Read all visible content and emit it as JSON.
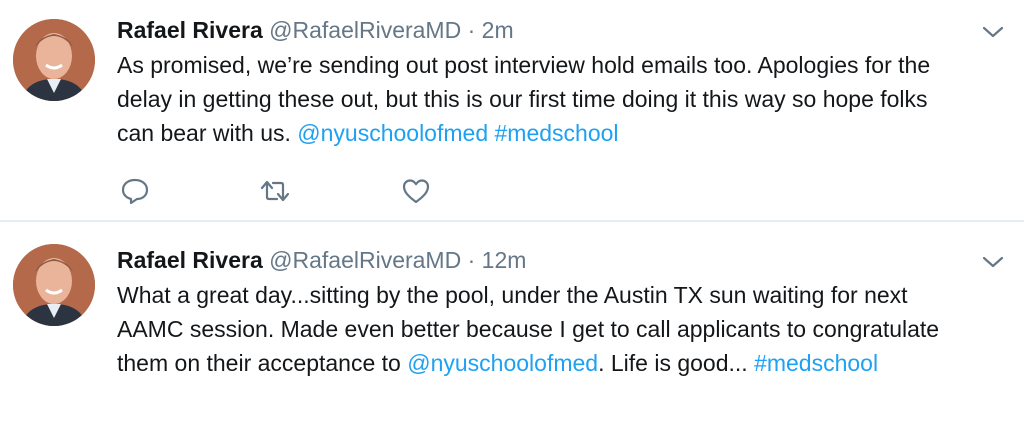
{
  "tweets": [
    {
      "name": "Rafael Rivera",
      "handle": "@RafaelRiveraMD",
      "separator": "·",
      "time": "2m",
      "text_1": "As promised, we’re sending out post interview hold emails too.  Apologies for the delay in getting these out, but this is our first time doing it this way so hope folks can bear with us.  ",
      "link_1": "@nyuschoolofmed",
      "text_2": " ",
      "link_2": "#medschool",
      "text_3": "",
      "link_3": "",
      "icons": {
        "reply": "reply-icon",
        "retweet": "retweet-icon",
        "like": "like-icon",
        "menu": "chevron-down-icon"
      }
    },
    {
      "name": "Rafael Rivera",
      "handle": "@RafaelRiveraMD",
      "separator": "·",
      "time": "12m",
      "text_1": "What a great day...sitting by the pool, under the Austin TX sun waiting for next AAMC session.  Made even better because I get to call applicants to congratulate them on their acceptance to ",
      "link_1": "@nyuschoolofmed",
      "text_2": ".  Life is good... ",
      "link_2": "#medschool",
      "text_3": "",
      "link_3": "",
      "icons": {
        "menu": "chevron-down-icon"
      }
    }
  ],
  "colors": {
    "link": "#1da1f2",
    "secondary_text": "#657786",
    "primary_text": "#14171a",
    "divider": "#e6ecf0"
  }
}
